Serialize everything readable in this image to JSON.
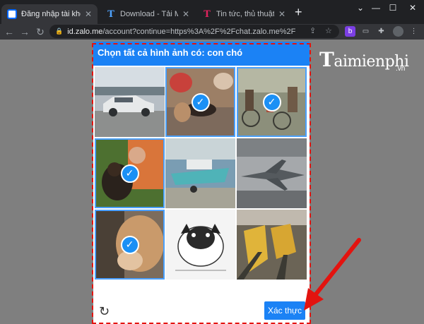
{
  "browser": {
    "tabs": [
      {
        "title": "Đăng nhập tài khoản Za",
        "favicon": "zalo-icon",
        "active": true
      },
      {
        "title": "Download - Tải Miễn Ph",
        "favicon": "t-icon",
        "active": false
      },
      {
        "title": "Tin tức, thủ thuật công",
        "favicon": "t-icon",
        "active": false
      }
    ],
    "url_host": "id.zalo.me",
    "url_rest": "/account?continue=https%3A%2F%2Fchat.zalo.me%2F"
  },
  "watermark": {
    "brand": "aimienphi",
    "brand_initial": "T",
    "tld": ".vn"
  },
  "captcha": {
    "instruction": "Chọn tất cả hình ảnh có: con chó",
    "tiles": [
      {
        "subject": "car-parking-lot",
        "selected": false
      },
      {
        "subject": "dogs-on-street",
        "selected": true
      },
      {
        "subject": "people-with-bicycles",
        "selected": true
      },
      {
        "subject": "man-with-dog",
        "selected": true
      },
      {
        "subject": "boat-on-trailer",
        "selected": false
      },
      {
        "subject": "fighter-jet",
        "selected": false
      },
      {
        "subject": "dog-closeup",
        "selected": true
      },
      {
        "subject": "pug-sketch",
        "selected": false
      },
      {
        "subject": "train-station",
        "selected": false
      }
    ],
    "verify_label": "Xác thực",
    "refresh_icon": "refresh-icon"
  },
  "colors": {
    "accent": "#1b82f5",
    "highlight": "#e3130f"
  }
}
